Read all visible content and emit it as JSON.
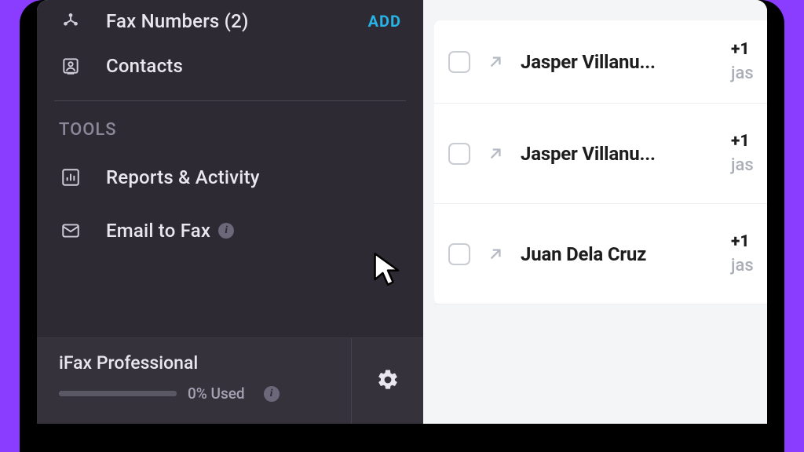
{
  "sidebar": {
    "items": [
      {
        "label": "Fax Numbers (2)",
        "action": "ADD"
      },
      {
        "label": "Contacts"
      }
    ],
    "tools_header": "TOOLS",
    "tools": [
      {
        "label": "Reports & Activity"
      },
      {
        "label": "Email to Fax"
      }
    ]
  },
  "plan": {
    "title": "iFax Professional",
    "usage_text": "0% Used",
    "usage_percent": 0
  },
  "list": {
    "rows": [
      {
        "name": "Jasper Villanu...",
        "line1": "+1",
        "line2": "jas"
      },
      {
        "name": "Jasper Villanu...",
        "line1": "+1",
        "line2": "jas"
      },
      {
        "name": "Juan Dela Cruz",
        "line1": "+1",
        "line2": "jas"
      }
    ]
  }
}
